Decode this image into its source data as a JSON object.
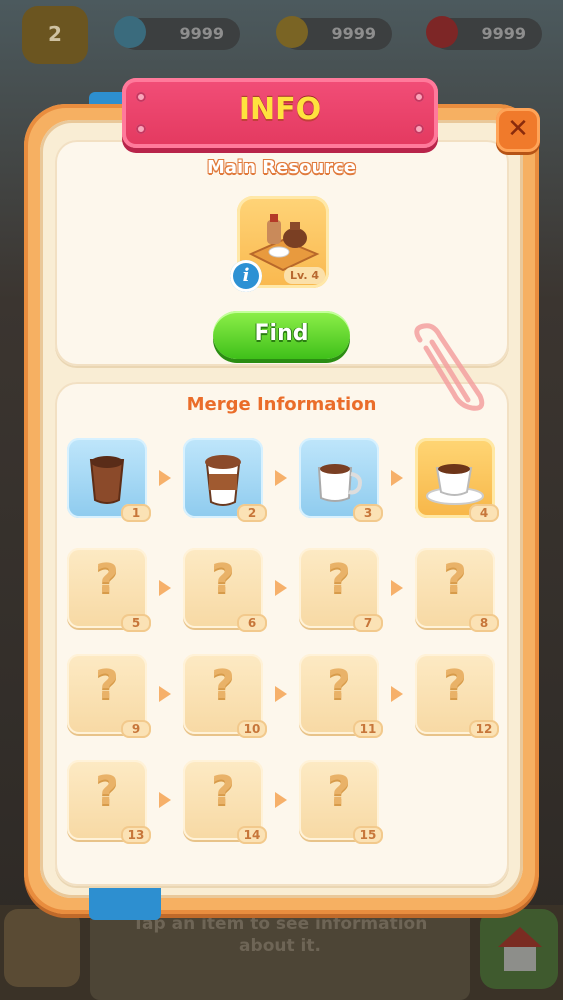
{
  "hud": {
    "level": "2",
    "resources": [
      {
        "icon": "energy-icon",
        "value": "9999"
      },
      {
        "icon": "coin-icon",
        "value": "9999"
      },
      {
        "icon": "gem-icon",
        "value": "9999"
      }
    ]
  },
  "dialog": {
    "title": "INFO",
    "close_label": "✕",
    "main_resource_title": "Main Resource",
    "main_resource": {
      "icon": "coffee-tray-icon",
      "level_label": "Lv. 4",
      "info_label": "i"
    },
    "find_label": "Find",
    "merge_title": "Merge Information",
    "merge_items": [
      {
        "num": "1",
        "state": "known",
        "icon": "paper-cup-icon"
      },
      {
        "num": "2",
        "state": "known",
        "icon": "coffee-cup-lid-icon"
      },
      {
        "num": "3",
        "state": "known",
        "icon": "mug-icon"
      },
      {
        "num": "4",
        "state": "current",
        "icon": "cup-saucer-icon"
      },
      {
        "num": "5",
        "state": "unknown"
      },
      {
        "num": "6",
        "state": "unknown"
      },
      {
        "num": "7",
        "state": "unknown"
      },
      {
        "num": "8",
        "state": "unknown"
      },
      {
        "num": "9",
        "state": "unknown"
      },
      {
        "num": "10",
        "state": "unknown"
      },
      {
        "num": "11",
        "state": "unknown"
      },
      {
        "num": "12",
        "state": "unknown"
      },
      {
        "num": "13",
        "state": "unknown"
      },
      {
        "num": "14",
        "state": "unknown"
      },
      {
        "num": "15",
        "state": "unknown"
      }
    ],
    "unknown_symbol": "?"
  },
  "bottom": {
    "hint_line1": "Tap an item to see information",
    "hint_line2": "about it."
  },
  "colors": {
    "panel": "#f6b062",
    "ribbon": "#e3395f",
    "title_yellow": "#ffe23e",
    "find_green": "#3fc01a",
    "accent_orange": "#ea6d2a"
  }
}
